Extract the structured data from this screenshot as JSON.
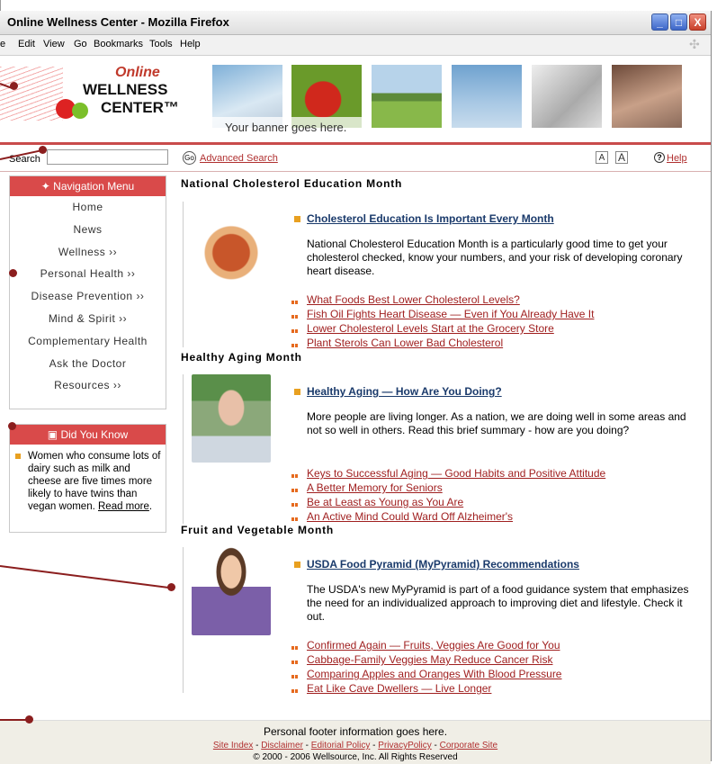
{
  "window": {
    "title": "Online Wellness Center - Mozilla Firefox",
    "minimize_label": "_",
    "maximize_label": "□",
    "close_label": "X"
  },
  "menubar": {
    "items": [
      "e",
      "Edit",
      "View",
      "Go",
      "Bookmarks",
      "Tools",
      "Help"
    ]
  },
  "logo": {
    "line1": "Online",
    "line2": "WELLNESS",
    "line3": "CENTER™"
  },
  "banner": {
    "text": "Your banner goes here."
  },
  "search": {
    "label": "Search",
    "go_label": "Go",
    "advanced_label": "Advanced Search",
    "font_small": "A",
    "font_large": "A",
    "help_icon": "?",
    "help_label": "Help"
  },
  "nav": {
    "heading": "Navigation Menu",
    "items": [
      "Home",
      "News",
      "Wellness ››",
      "Personal Health ››",
      "Disease Prevention ››",
      "Mind & Spirit ››",
      "Complementary Health",
      "Ask the Doctor",
      "Resources ››"
    ]
  },
  "did_you_know": {
    "heading": "Did You Know",
    "text": "Women who consume lots of dairy such as milk and cheese are five times more likely to have twins than vegan women.",
    "link": "Read more"
  },
  "sections": [
    {
      "title": "National Cholesterol Education Month",
      "headline": "Cholesterol Education Is Important Every Month",
      "blurb": "National Cholesterol Education Month is a particularly good time to get your cholesterol checked, know your numbers, and your risk of developing coronary heart disease.",
      "links": [
        "What Foods Best Lower Cholesterol Levels?",
        "Fish Oil Fights Heart Disease — Even if You Already Have It",
        "Lower Cholesterol Levels Start at the Grocery Store",
        "Plant Sterols Can Lower Bad Cholesterol"
      ]
    },
    {
      "title": "Healthy Aging Month",
      "headline": "Healthy Aging — How Are You Doing?",
      "blurb": "More people are living longer. As a nation, we are doing well in some areas and not so well in others. Read this brief summary - how are you doing?",
      "links": [
        "Keys to Successful Aging — Good Habits and Positive Attitude",
        "A Better Memory for Seniors",
        "Be at Least as Young as You Are",
        "An Active Mind Could Ward Off Alzheimer's"
      ]
    },
    {
      "title": "Fruit and Vegetable Month",
      "headline": "USDA Food Pyramid (MyPyramid) Recommendations",
      "blurb": "The USDA's new MyPyramid is part of a food guidance system that emphasizes the need for an individualized approach to improving diet and lifestyle. Check it out.",
      "links": [
        "Confirmed Again — Fruits, Veggies Are Good for You",
        "Cabbage-Family Veggies May Reduce Cancer Risk",
        "Comparing Apples and Oranges With Blood Pressure",
        "Eat Like Cave Dwellers — Live Longer"
      ]
    }
  ],
  "footer": {
    "main": "Personal footer information goes here.",
    "links": [
      "Site Index",
      "Disclaimer",
      "Editorial Policy",
      "PrivacyPolicy",
      "Corporate Site"
    ],
    "separator": " - ",
    "copyright": "© 2000 - 2006 Wellsource, Inc. All Rights Reserved"
  },
  "colors": {
    "accent_red": "#d94a4a",
    "link_red": "#a02020",
    "headline_blue": "#1a3a6b",
    "bullet_orange": "#e8a020",
    "callout": "#8b1e1e"
  }
}
